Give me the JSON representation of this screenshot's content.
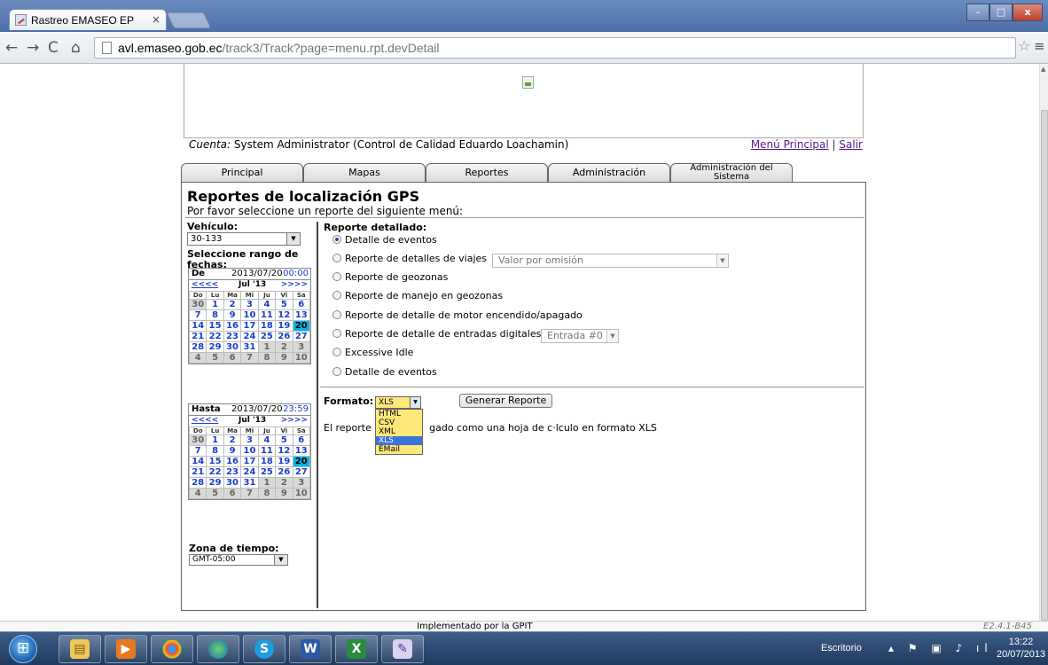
{
  "browser": {
    "tab_title": "Rastreo EMASEO EP",
    "tab_close": "×",
    "url_host": "avl.emaseo.gob.ec",
    "url_path": "/track3/Track?page=menu.rpt.devDetail"
  },
  "header": {
    "account_label": "Cuenta:",
    "account_value": "System Administrator (Control de Calidad Eduardo Loachamin)",
    "link_main_menu": "Menú Principal",
    "link_separator": "|",
    "link_logout": "Salir"
  },
  "tabs": [
    {
      "label": "Principal"
    },
    {
      "label": "Mapas"
    },
    {
      "label": "Reportes"
    },
    {
      "label": "Administración"
    },
    {
      "label_line1": "Administración del",
      "label_line2": "Sistema"
    }
  ],
  "page": {
    "title": "Reportes de localización GPS",
    "subtitle": "Por favor seleccione un reporte del siguiente menú:"
  },
  "left": {
    "vehicle_label": "Vehículo:",
    "vehicle_value": "30-133",
    "range_label": "Seleccione rango de fechas:",
    "timezone_label": "Zona de tiempo:",
    "timezone_value": "GMT-05:00"
  },
  "calendar_from": {
    "label": "De",
    "date": "2013/07/20",
    "time": "00:00",
    "prev": "<<<<",
    "month": "Jul '13",
    "next": ">>>>",
    "weekdays": [
      "Do",
      "Lu",
      "Ma",
      "Mi",
      "Ju",
      "Vi",
      "Sa"
    ],
    "days": [
      "30",
      "1",
      "2",
      "3",
      "4",
      "5",
      "6",
      "7",
      "8",
      "9",
      "10",
      "11",
      "12",
      "13",
      "14",
      "15",
      "16",
      "17",
      "18",
      "19",
      "20",
      "21",
      "22",
      "23",
      "24",
      "25",
      "26",
      "27",
      "28",
      "29",
      "30",
      "31",
      "1",
      "2",
      "3",
      "4",
      "5",
      "6",
      "7",
      "8",
      "9",
      "10"
    ]
  },
  "calendar_to": {
    "label": "Hasta",
    "date": "2013/07/20",
    "time": "23:59",
    "prev": "<<<<",
    "month": "Jul '13",
    "next": ">>>>",
    "weekdays": [
      "Do",
      "Lu",
      "Ma",
      "Mi",
      "Ju",
      "Vi",
      "Sa"
    ],
    "days": [
      "30",
      "1",
      "2",
      "3",
      "4",
      "5",
      "6",
      "7",
      "8",
      "9",
      "10",
      "11",
      "12",
      "13",
      "14",
      "15",
      "16",
      "17",
      "18",
      "19",
      "20",
      "21",
      "22",
      "23",
      "24",
      "25",
      "26",
      "27",
      "28",
      "29",
      "30",
      "31",
      "1",
      "2",
      "3",
      "4",
      "5",
      "6",
      "7",
      "8",
      "9",
      "10"
    ]
  },
  "report": {
    "title": "Reporte detallado:",
    "options": [
      {
        "label": "Detalle de eventos",
        "selected": true
      },
      {
        "label": "Reporte de detalles de viajes"
      },
      {
        "label": "Reporte de geozonas"
      },
      {
        "label": "Reporte de manejo en geozonas"
      },
      {
        "label": "Reporte de detalle de motor encendido/apagado"
      },
      {
        "label": "Reporte de detalle de entradas digitales"
      },
      {
        "label": "Excessive Idle"
      },
      {
        "label": "Detalle de eventos"
      }
    ],
    "trip_select_value": "Valor por omisión",
    "input_select_value": "Entrada #0"
  },
  "format": {
    "label": "Formato:",
    "value": "XLS",
    "options": [
      "HTML",
      "CSV",
      "XML",
      "XLS",
      "EMail"
    ],
    "generate_button": "Generar Reporte",
    "description_start": "El reporte s",
    "description_end": "gado como una hoja de c·lculo en formato XLS"
  },
  "footer": {
    "implemented_by": "Implementado por la GPIT",
    "version": "E2.4.1-B45"
  },
  "taskbar": {
    "desktop_label": "Escritorio",
    "time": "13:22",
    "date": "20/07/2013"
  },
  "colors": {
    "selected_day": "#00b4e8",
    "link_day": "#1b3fcc",
    "format_select_bg": "#ffe87a",
    "dropdown_highlight": "#3b74d9"
  }
}
